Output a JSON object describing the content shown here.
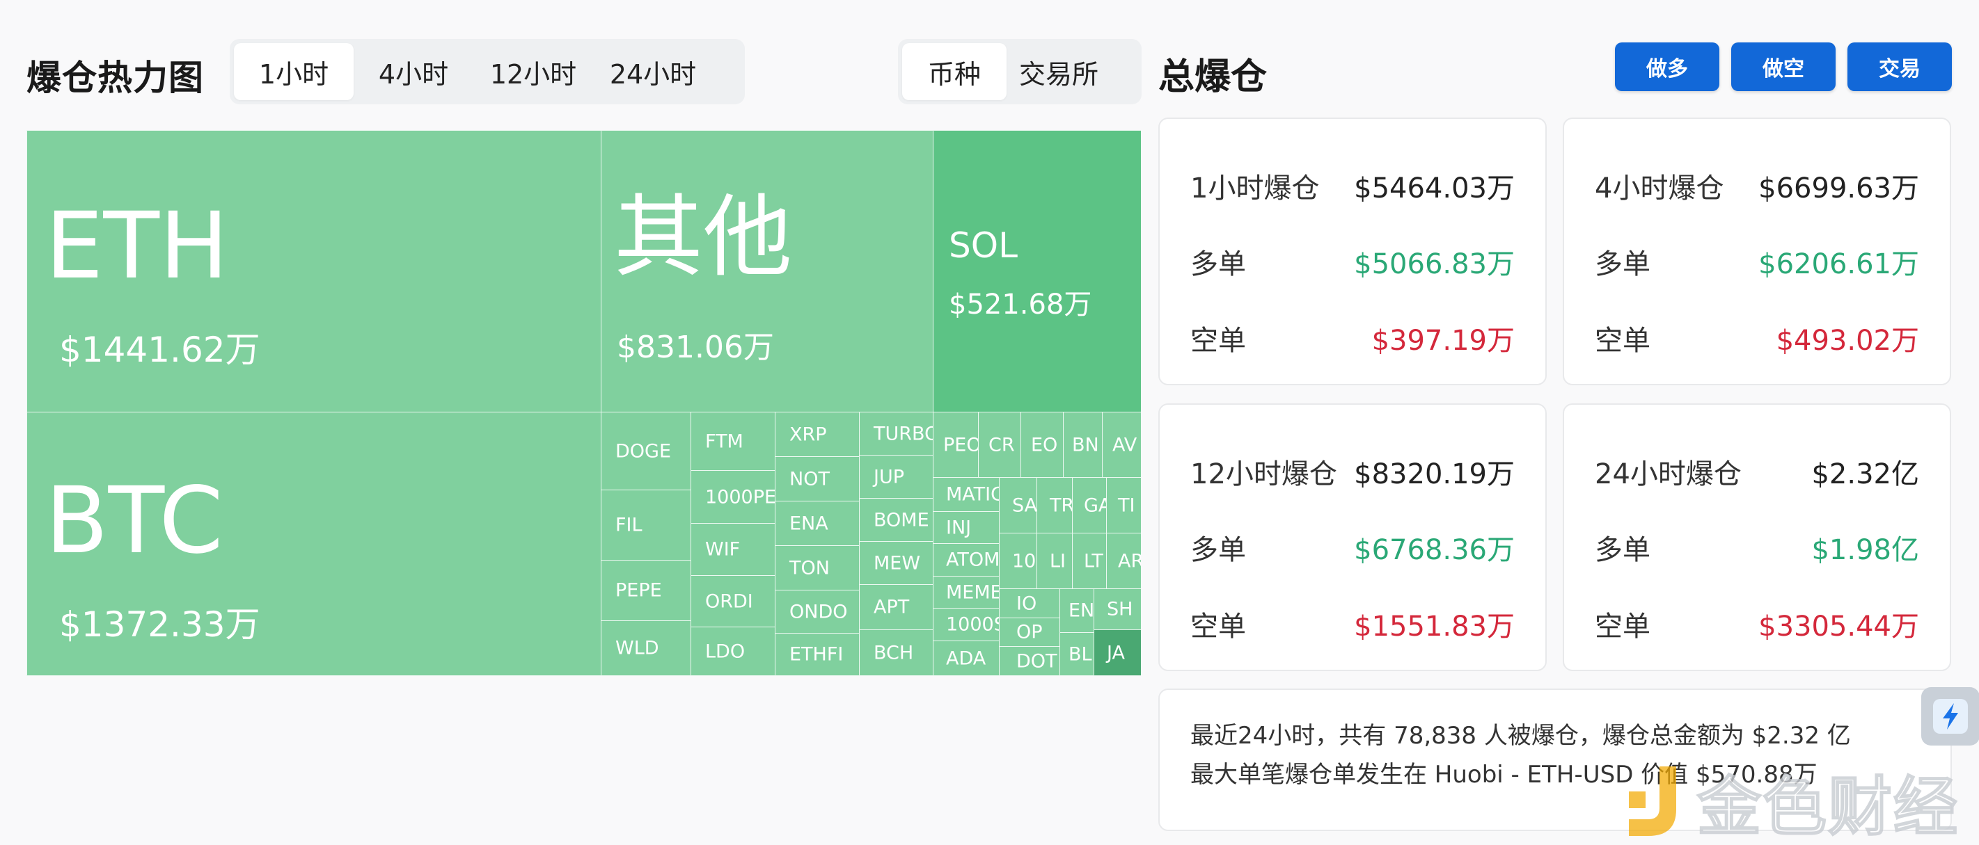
{
  "heatmap": {
    "title": "爆仓热力图",
    "time_tabs": [
      "1小时",
      "4小时",
      "12小时",
      "24小时"
    ],
    "active_time_tab": 0,
    "group_tabs": [
      "币种",
      "交易所"
    ],
    "active_group_tab": 0,
    "tiles": {
      "eth": {
        "name": "ETH",
        "value": "$1441.62万"
      },
      "btc": {
        "name": "BTC",
        "value": "$1372.33万"
      },
      "other": {
        "name": "其他",
        "value": "$831.06万"
      },
      "sol": {
        "name": "SOL",
        "value": "$521.68万"
      },
      "small": [
        "DOGE",
        "FIL",
        "PEPE",
        "WLD",
        "FTM",
        "1000PE",
        "WIF",
        "ORDI",
        "LDO",
        "XRP",
        "NOT",
        "ENA",
        "TON",
        "ONDO",
        "ETHFI",
        "TURBO",
        "JUP",
        "BOME",
        "MEW",
        "APT",
        "BCH",
        "PEO",
        "CR",
        "EO",
        "BN",
        "AV",
        "MATIC",
        "INJ",
        "ATOM",
        "MEME",
        "1000S",
        "ADA",
        "SA",
        "10",
        "TR",
        "LI",
        "GA",
        "LT",
        "TI",
        "AR",
        "IO",
        "OP",
        "DOT",
        "EN",
        "BL",
        "SH",
        "JA"
      ]
    }
  },
  "total": {
    "title": "总爆仓",
    "buttons": {
      "long": "做多",
      "short": "做空",
      "trade": "交易"
    },
    "cards": [
      {
        "title": "1小时爆仓",
        "total": "$5464.03万",
        "long_label": "多单",
        "long": "$5066.83万",
        "short_label": "空单",
        "short": "$397.19万"
      },
      {
        "title": "4小时爆仓",
        "total": "$6699.63万",
        "long_label": "多单",
        "long": "$6206.61万",
        "short_label": "空单",
        "short": "$493.02万"
      },
      {
        "title": "12小时爆仓",
        "total": "$8320.19万",
        "long_label": "多单",
        "long": "$6768.36万",
        "short_label": "空单",
        "short": "$1551.83万"
      },
      {
        "title": "24小时爆仓",
        "total": "$2.32亿",
        "long_label": "多单",
        "long": "$1.98亿",
        "short_label": "空单",
        "short": "$3305.44万"
      }
    ],
    "summary_line1": "最近24小时，共有 78,838 人被爆仓，爆仓总金额为 $2.32 亿",
    "summary_line2": "最大单笔爆仓单发生在 Huobi - ETH-USD 价值 $570.88万"
  },
  "watermark": {
    "text": "金色财经"
  },
  "colors": {
    "accent": "#1268d8",
    "tile": "#80d09e",
    "green": "#2aa876",
    "red": "#d4283b"
  }
}
